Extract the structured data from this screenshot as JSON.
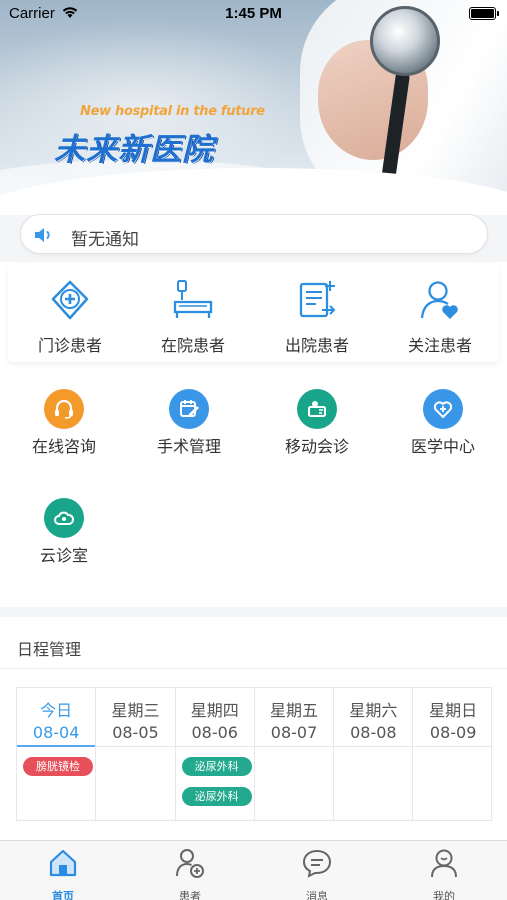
{
  "status_bar": {
    "carrier": "Carrier",
    "time": "1:45 PM"
  },
  "banner": {
    "subtitle_en": "New hospital in the future",
    "title_cn": "未来新医院"
  },
  "notice": {
    "text": "暂无通知",
    "icon": "speaker-icon"
  },
  "patient_menu": [
    {
      "label": "门诊患者",
      "icon": "outpatient-icon"
    },
    {
      "label": "在院患者",
      "icon": "inpatient-bed-icon"
    },
    {
      "label": "出院患者",
      "icon": "discharge-icon"
    },
    {
      "label": "关注患者",
      "icon": "followed-patient-icon"
    }
  ],
  "service_menu": [
    {
      "label": "在线咨询",
      "icon": "headset-icon",
      "color": "#f39a2b"
    },
    {
      "label": "手术管理",
      "icon": "calendar-edit-icon",
      "color": "#3a97e8"
    },
    {
      "label": "移动会诊",
      "icon": "consult-icon",
      "color": "#19a58a"
    },
    {
      "label": "医学中心",
      "icon": "heart-stethoscope-icon",
      "color": "#3a97e8"
    },
    {
      "label": "云诊室",
      "icon": "cloud-clinic-icon",
      "color": "#19a58a"
    }
  ],
  "schedule": {
    "title": "日程管理",
    "days": [
      {
        "day": "今日",
        "date": "08-04",
        "today": true,
        "events": [
          {
            "label": "膀胱镜检",
            "color": "red"
          }
        ]
      },
      {
        "day": "星期三",
        "date": "08-05",
        "events": []
      },
      {
        "day": "星期四",
        "date": "08-06",
        "events": [
          {
            "label": "泌尿外科",
            "color": "green"
          },
          {
            "label": "泌尿外科",
            "color": "green"
          }
        ]
      },
      {
        "day": "星期五",
        "date": "08-07",
        "events": []
      },
      {
        "day": "星期六",
        "date": "08-08",
        "events": []
      },
      {
        "day": "星期日",
        "date": "08-09",
        "events": []
      }
    ]
  },
  "tabbar": [
    {
      "label": "首页",
      "icon": "home-icon",
      "active": true
    },
    {
      "label": "患者",
      "icon": "patient-add-icon",
      "active": false
    },
    {
      "label": "消息",
      "icon": "message-icon",
      "active": false
    },
    {
      "label": "我的",
      "icon": "profile-icon",
      "active": false
    }
  ],
  "colors": {
    "accent": "#2a8be0",
    "event_red": "#e5505a",
    "event_green": "#23a98d"
  }
}
